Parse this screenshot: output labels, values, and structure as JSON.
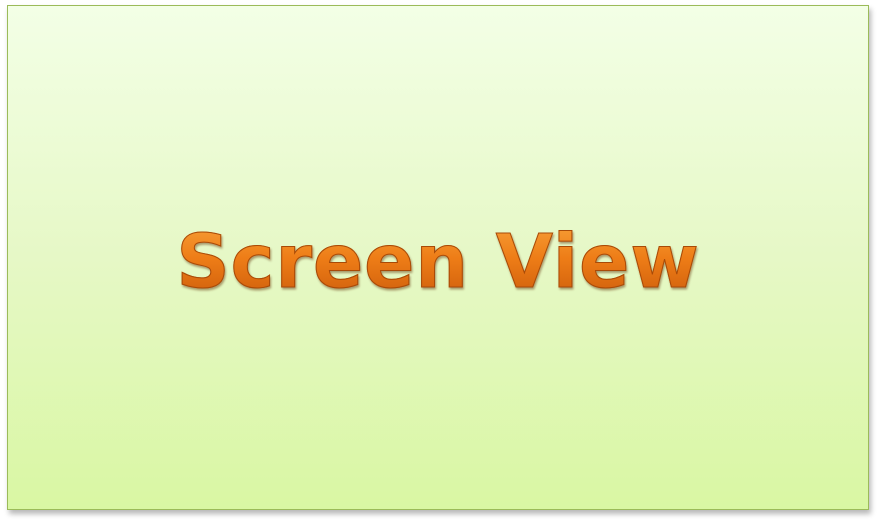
{
  "slide": {
    "title": "Screen View"
  },
  "colors": {
    "background_top": "#f3ffe6",
    "background_bottom": "#d9f7a3",
    "border": "#9bbb59",
    "title_light": "#f7a23a",
    "title_dark": "#c9590a"
  }
}
